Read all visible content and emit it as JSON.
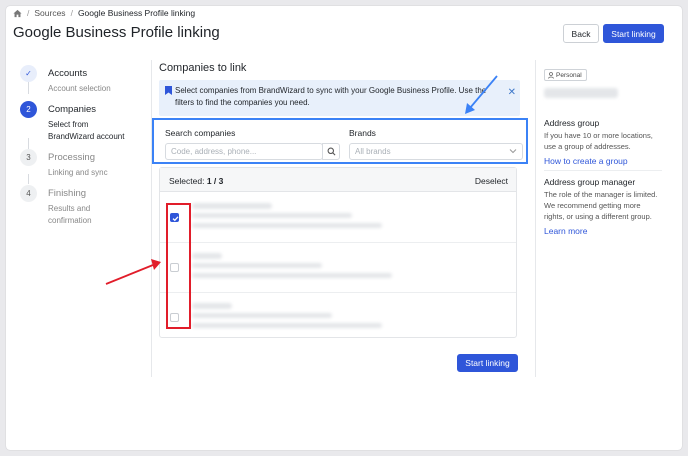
{
  "breadcrumb": {
    "sources": "Sources",
    "current": "Google Business Profile linking"
  },
  "page": {
    "title": "Google Business Profile linking"
  },
  "header": {
    "back_label": "Back",
    "start_label": "Start linking"
  },
  "steps": [
    {
      "number": "✓",
      "title": "Accounts",
      "sub": [
        "Account selection"
      ],
      "state": "done"
    },
    {
      "number": "2",
      "title": "Companies",
      "sub": [
        "Select from",
        "BrandWizard account"
      ],
      "state": "active"
    },
    {
      "number": "3",
      "title": "Processing",
      "sub": [
        "Linking and sync"
      ],
      "state": "pending"
    },
    {
      "number": "4",
      "title": "Finishing",
      "sub": [
        "Results and",
        "confirmation"
      ],
      "state": "pending"
    }
  ],
  "main": {
    "section_title": "Companies to link",
    "info_text": "Select companies from BrandWizard to sync with your Google Business Profile. Use the filters to find the companies you need.",
    "search": {
      "label": "Search companies",
      "placeholder": "Code, address, phone..."
    },
    "brands": {
      "label": "Brands",
      "placeholder": "All brands"
    },
    "list": {
      "selected_label": "Selected: ",
      "selected_count": "1 / 3",
      "deselect_label": "Deselect",
      "rows": [
        {
          "checked": true
        },
        {
          "checked": false
        },
        {
          "checked": false
        }
      ]
    },
    "start_label": "Start linking"
  },
  "right_panel": {
    "badge": "Personal",
    "address_group": {
      "title": "Address group",
      "text": "If you have 10 or more locations, use a group of addresses.",
      "link": "How to create a group"
    },
    "manager": {
      "title": "Address group manager",
      "text": "The role of the manager is limited. We recommend getting more rights, or using a different group.",
      "link": "Learn more"
    }
  },
  "colors": {
    "accent": "#2f56d9",
    "highlight_blue": "#3b82f6",
    "highlight_red": "#e11d2a",
    "info_bg": "#e8f0fb"
  }
}
